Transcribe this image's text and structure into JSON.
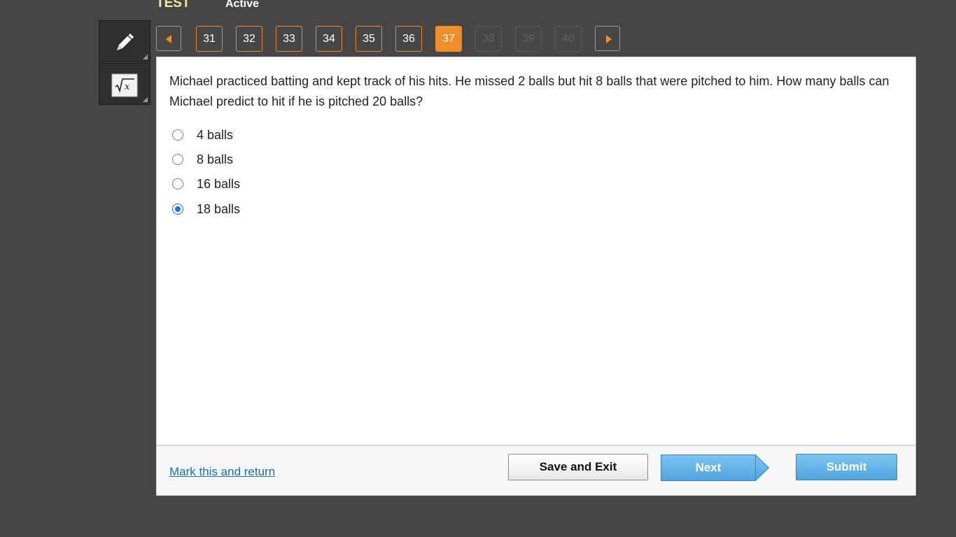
{
  "header": {
    "title": "TEST",
    "status": "Active"
  },
  "toolbar": {
    "tools": [
      {
        "name": "pencil",
        "icon": "pencil-icon"
      },
      {
        "name": "calculator",
        "icon": "square-root-icon"
      }
    ]
  },
  "navigation": {
    "prev_icon": "chevron-left-icon",
    "next_icon": "chevron-right-icon",
    "questions": [
      {
        "label": "31",
        "state": "answered"
      },
      {
        "label": "32",
        "state": "answered"
      },
      {
        "label": "33",
        "state": "answered"
      },
      {
        "label": "34",
        "state": "answered"
      },
      {
        "label": "35",
        "state": "answered"
      },
      {
        "label": "36",
        "state": "answered"
      },
      {
        "label": "37",
        "state": "current"
      },
      {
        "label": "38",
        "state": "disabled"
      },
      {
        "label": "39",
        "state": "disabled"
      },
      {
        "label": "40",
        "state": "disabled"
      }
    ]
  },
  "question": {
    "text": "Michael practiced batting and kept track of his hits. He missed 2 balls but hit 8 balls that were pitched to him. How many balls can Michael predict to hit if he is pitched 20 balls?",
    "options": [
      {
        "label": "4 balls",
        "selected": false
      },
      {
        "label": "8 balls",
        "selected": false
      },
      {
        "label": "16 balls",
        "selected": false
      },
      {
        "label": "18 balls",
        "selected": true
      }
    ]
  },
  "footer": {
    "mark_label": "Mark this and return",
    "save_label": "Save and Exit",
    "next_label": "Next",
    "submit_label": "Submit"
  },
  "colors": {
    "background": "#464646",
    "accent_orange": "#f28c28",
    "title_yellow": "#f6e4a4",
    "button_blue": "#5aaee3",
    "link_blue": "#1a6fa8",
    "radio_blue": "#1a73e8"
  }
}
